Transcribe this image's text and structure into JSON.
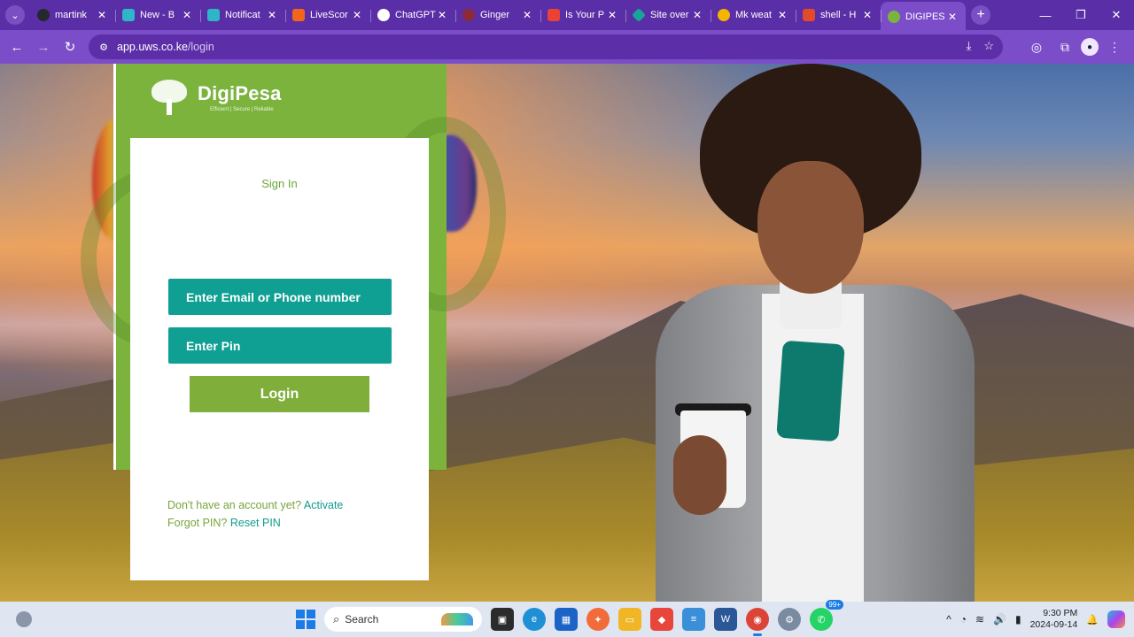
{
  "browser": {
    "tabs": [
      {
        "title": "martink",
        "favicon_color": "#24292f"
      },
      {
        "title": "New - B",
        "favicon_color": "#2fb5c8"
      },
      {
        "title": "Notificat",
        "favicon_color": "#2fb5c8"
      },
      {
        "title": "LiveScor",
        "favicon_color": "#f2661c"
      },
      {
        "title": "ChatGPT",
        "favicon_color": "#ffffff"
      },
      {
        "title": "Ginger",
        "favicon_color": "#8a2a3a"
      },
      {
        "title": "Is Your P",
        "favicon_color": "#ea4335"
      },
      {
        "title": "Site over",
        "favicon_color": "#17a59a"
      },
      {
        "title": "Mk weat",
        "favicon_color": "#f4b400"
      },
      {
        "title": "shell - H",
        "favicon_color": "#e24a2a"
      },
      {
        "title": "DIGIPES",
        "favicon_color": "#7bb33d",
        "active": true
      }
    ],
    "close_glyph": "✕",
    "new_tab_glyph": "+",
    "menu_glyph": "⌄",
    "window_controls": [
      "—",
      "❐",
      "✕"
    ],
    "nav": {
      "back": "←",
      "forward": "→",
      "reload": "↻"
    },
    "url_host": "app.uws.co.ke",
    "url_path": "/login",
    "omni_icons": [
      "⤓",
      "☆"
    ],
    "right_icons": [
      "◎",
      "⧉"
    ]
  },
  "login": {
    "brand": "DigiPesa",
    "tagline": "Efficient | Secure | Reliable",
    "heading": "Sign In",
    "email_placeholder": "Enter Email or Phone number",
    "pin_placeholder": "Enter Pin",
    "login_label": "Login",
    "no_account_text": "Don't have an account yet?",
    "activate_link": "Activate",
    "forgot_text": "Forgot PIN?",
    "reset_link": "Reset PIN"
  },
  "taskbar": {
    "search_label": "Search",
    "search_glyph": "⌕",
    "apps": [
      {
        "name": "task-view",
        "glyph": "▣",
        "color": "#2b2b2b"
      },
      {
        "name": "edge",
        "glyph": "e",
        "color": "#1f8fd6"
      },
      {
        "name": "store",
        "glyph": "▦",
        "color": "#1b63c6"
      },
      {
        "name": "postman",
        "glyph": "✦",
        "color": "#f26b3a"
      },
      {
        "name": "explorer",
        "glyph": "▭",
        "color": "#f0b626"
      },
      {
        "name": "anydesk",
        "glyph": "◆",
        "color": "#e8463b"
      },
      {
        "name": "notepad",
        "glyph": "≡",
        "color": "#3a8fd8"
      },
      {
        "name": "word",
        "glyph": "W",
        "color": "#2b5797"
      },
      {
        "name": "chrome",
        "glyph": "◉",
        "color": "#db4437",
        "active": true
      },
      {
        "name": "settings",
        "glyph": "⚙",
        "color": "#7a8aa0"
      },
      {
        "name": "whatsapp",
        "glyph": "✆",
        "color": "#25d366",
        "badge": "99+"
      }
    ],
    "tray_glyphs": [
      "^",
      "◔",
      "≋",
      "🔊",
      "▮"
    ],
    "bell_glyph": "🔔",
    "time": "9:30 PM",
    "date": "2024-09-14"
  }
}
